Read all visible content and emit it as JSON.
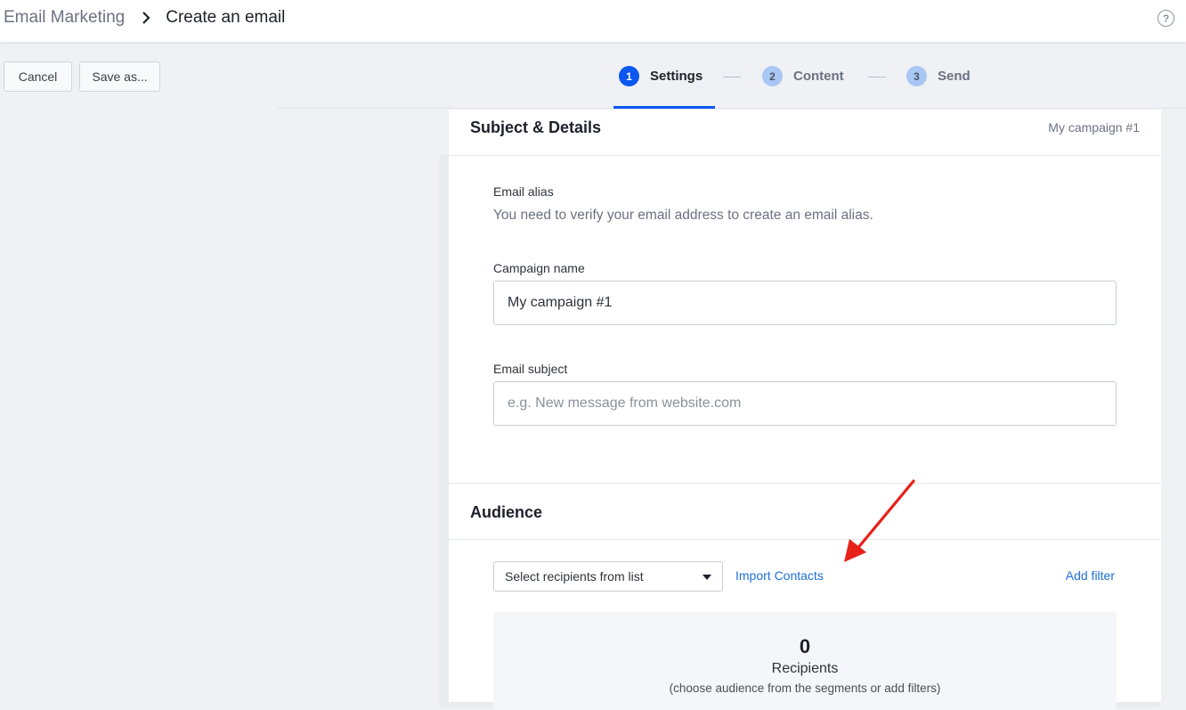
{
  "header": {
    "breadcrumb_root": "Email Marketing",
    "breadcrumb_current": "Create an email",
    "help_icon": "question-circle-icon"
  },
  "actions": {
    "cancel_label": "Cancel",
    "save_as_label": "Save as..."
  },
  "stepper": {
    "steps": [
      {
        "number": "1",
        "label": "Settings",
        "active": true
      },
      {
        "number": "2",
        "label": "Content",
        "active": false
      },
      {
        "number": "3",
        "label": "Send",
        "active": false
      }
    ],
    "accent_color": "#0b57f0"
  },
  "details": {
    "title": "Subject & Details",
    "campaign_badge": "My campaign #1",
    "email_alias_label": "Email alias",
    "email_alias_hint": "You need to verify your email address to create an email alias.",
    "campaign_name_label": "Campaign name",
    "campaign_name_value": "My campaign #1",
    "email_subject_label": "Email subject",
    "email_subject_placeholder": "e.g. New message from website.com"
  },
  "audience": {
    "title": "Audience",
    "select_value": "Select recipients from list",
    "import_contacts_label": "Import Contacts",
    "add_filter_label": "Add filter",
    "recipients_count": "0",
    "recipients_label": "Recipients",
    "recipients_hint": "(choose audience from the segments or add filters)"
  },
  "annotation": {
    "arrow_color": "#e8201a"
  }
}
